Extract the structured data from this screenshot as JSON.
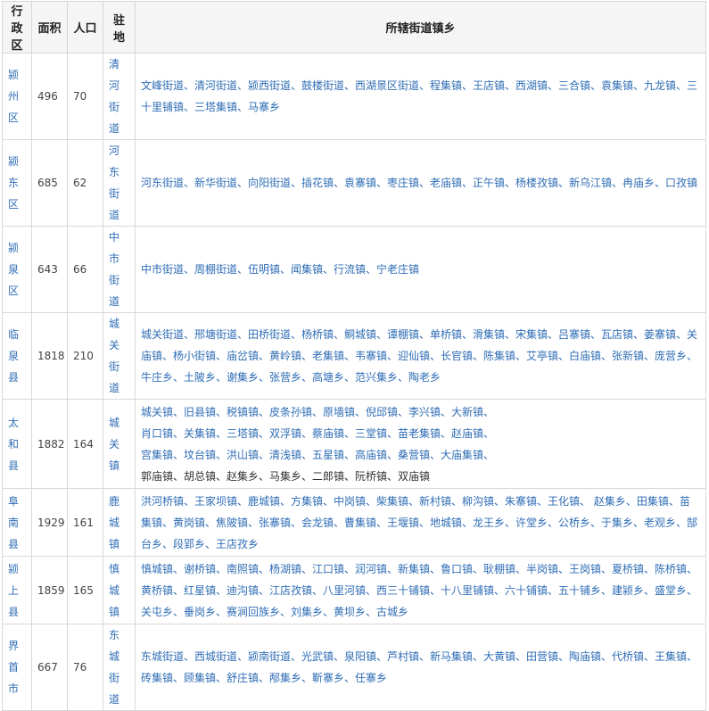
{
  "headers": {
    "district": "行政区",
    "area": "面积",
    "population": "人口",
    "seat": "驻地",
    "towns": "所辖街道镇乡"
  },
  "rows": [
    {
      "name": "颍州区",
      "area": "496",
      "population": "70",
      "seat": "清河街道",
      "towns": "文峰街道、清河街道、颍西街道、鼓楼街道、西湖景区街道、程集镇、王店镇、西湖镇、三合镇、袁集镇、九龙镇、三十里铺镇、三塔集镇、马寨乡"
    },
    {
      "name": "颍东区",
      "area": "685",
      "population": "62",
      "seat": "河东街道",
      "towns": "河东街道、新华街道、向阳街道、插花镇、袁寨镇、枣庄镇、老庙镇、正午镇、杨楼孜镇、新乌江镇、冉庙乡、口孜镇"
    },
    {
      "name": "颍泉区",
      "area": "643",
      "population": "66",
      "seat": "中市街道",
      "towns": "中市街道、周棚街道、伍明镇、闻集镇、行流镇、宁老庄镇"
    },
    {
      "name": "临泉县",
      "area": "1818",
      "population": "210",
      "seat": "城关街道",
      "towns": "城关街道、邢塘街道、田桥街道、杨桥镇、鲖城镇、谭棚镇、单桥镇、滑集镇、宋集镇、吕寨镇、瓦店镇、姜寨镇、关庙镇、杨小街镇、庙岔镇、黄岭镇、老集镇、韦寨镇、迎仙镇、长官镇、陈集镇、艾亭镇、白庙镇、张新镇、庞营乡、牛庄乡、土陂乡、谢集乡、张营乡、高塘乡、范兴集乡、陶老乡"
    },
    {
      "name": "太和县",
      "area": "1882",
      "population": "164",
      "seat": "城关镇",
      "towns_lines": [
        "城关镇、旧县镇、税镇镇、皮条孙镇、原墙镇、倪邱镇、李兴镇、大新镇、",
        "肖口镇、关集镇、三塔镇、双浮镇、蔡庙镇、三堂镇、苗老集镇、赵庙镇、",
        "宫集镇、坟台镇、洪山镇、清浅镇、五星镇、高庙镇、桑营镇、大庙集镇、"
      ],
      "towns_plain": "郭庙镇、胡总镇、赵集乡、马集乡、二郎镇、阮桥镇、双庙镇"
    },
    {
      "name": "阜南县",
      "area": "1929",
      "population": "161",
      "seat": "鹿城镇",
      "towns": "洪河桥镇、王家坝镇、鹿城镇、方集镇、中岗镇、柴集镇、新村镇、柳沟镇、朱寨镇、王化镇、 赵集乡、田集镇、苗集镇、黄岗镇、焦陂镇、张寨镇、会龙镇、曹集镇、王堰镇、地城镇、龙王乡、许堂乡、公桥乡、于集乡、老观乡、郜台乡、段郢乡、王店孜乡"
    },
    {
      "name": "颍上县",
      "area": "1859",
      "population": "165",
      "seat": "慎城镇",
      "towns": "慎城镇、谢桥镇、南照镇、杨湖镇、江口镇、润河镇、新集镇、鲁口镇、耿棚镇、半岗镇、王岗镇、夏桥镇、陈桥镇、黄桥镇、红星镇、迪沟镇、江店孜镇、八里河镇、西三十铺镇、十八里铺镇、六十铺镇、五十铺乡、建颍乡、盛堂乡、关屯乡、垂岗乡、赛涧回族乡、刘集乡、黄坝乡、古城乡"
    },
    {
      "name": "界首市",
      "area": "667",
      "population": "76",
      "seat": "东城街道",
      "towns": "东城街道、西城街道、颍南街道、光武镇、泉阳镇、芦村镇、新马集镇、大黄镇、田营镇、陶庙镇、代桥镇、王集镇、砖集镇、顾集镇、舒庄镇、邴集乡、靳寨乡、任寨乡"
    }
  ]
}
